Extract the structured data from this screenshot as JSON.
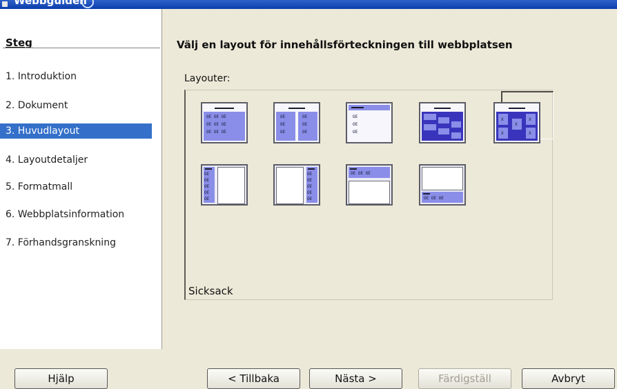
{
  "window": {
    "title": "Webbguiden"
  },
  "steps": {
    "heading": "Steg",
    "items": [
      {
        "label": "1. Introduktion"
      },
      {
        "label": "2. Dokument"
      },
      {
        "label": "3. Huvudlayout",
        "selected": true
      },
      {
        "label": "4. Layoutdetaljer"
      },
      {
        "label": "5. Formatmall"
      },
      {
        "label": "6. Webbplatsinformation"
      },
      {
        "label": "7. Förhandsgranskning"
      }
    ]
  },
  "main": {
    "title": "Välj en layout för innehållsförteckningen till webbplatsen",
    "layouts_label": "Layouter:",
    "selected_layout_name": "Sicksack",
    "thumb_text": "OE OE OE",
    "thumb_short": "OE",
    "thumb_icon": "X"
  },
  "buttons": {
    "help": "Hjälp",
    "back": "< Tillbaka",
    "next": "Nästa >",
    "finish": "Färdigställ",
    "cancel": "Avbryt"
  },
  "colors": {
    "selection": "#3470c9",
    "thumb_light": "#8a8ee8",
    "thumb_dark": "#3a34bc"
  }
}
